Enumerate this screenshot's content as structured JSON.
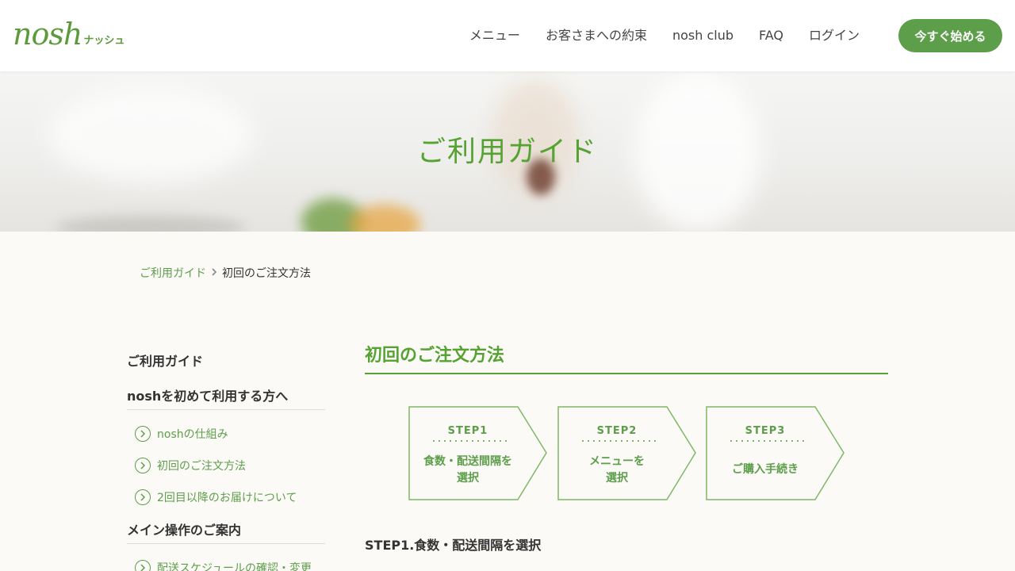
{
  "header": {
    "logo_main": "nosh",
    "logo_kana": "ナッシュ",
    "nav": [
      "メニュー",
      "お客さまへの約束",
      "nosh club",
      "FAQ",
      "ログイン"
    ],
    "cta": "今すぐ始める"
  },
  "hero": {
    "title": "ご利用ガイド"
  },
  "breadcrumb": {
    "parent": "ご利用ガイド",
    "current": "初回のご注文方法"
  },
  "sidebar": {
    "title": "ご利用ガイド",
    "sections": [
      {
        "heading": "noshを初めて利用する方へ",
        "links": [
          "noshの仕組み",
          "初回のご注文方法",
          "2回目以降のお届けについて"
        ]
      },
      {
        "heading": "メイン操作のご案内",
        "links": [
          "配送スケジュールの確認・変更"
        ]
      }
    ]
  },
  "main": {
    "title": "初回のご注文方法",
    "steps": [
      {
        "label": "STEP1",
        "desc_lines": [
          "食数・配送間隔を",
          "選択"
        ]
      },
      {
        "label": "STEP2",
        "desc_lines": [
          "メニューを",
          "選択"
        ]
      },
      {
        "label": "STEP3",
        "desc_lines": [
          "ご購入手続き"
        ]
      }
    ],
    "step1_heading": "STEP1.食数・配送間隔を選択"
  },
  "colors": {
    "brand_green": "#5d9e4a",
    "heading_green": "#56a232"
  }
}
